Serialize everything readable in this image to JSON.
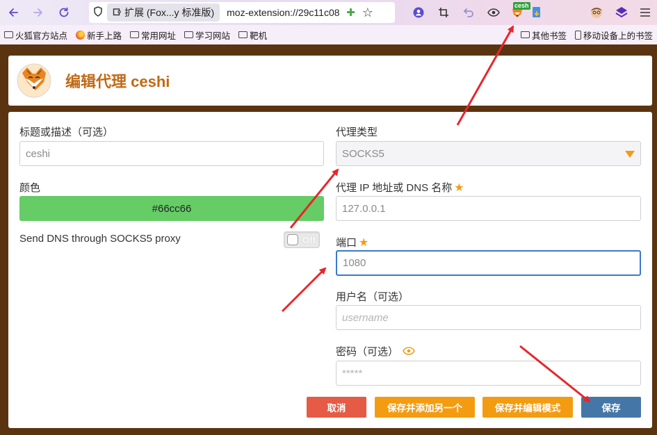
{
  "browser": {
    "tab_label": "扩展 (Fox...y 标准版)",
    "url": "moz-extension://29c11c08",
    "extension_badge": "cesh"
  },
  "bookmarks": {
    "left": [
      "火狐官方站点",
      "新手上路",
      "常用网址",
      "学习网站",
      "靶机"
    ],
    "right": [
      "其他书签",
      "移动设备上的书签"
    ]
  },
  "header": {
    "title": "编辑代理 ceshi"
  },
  "form": {
    "title_label": "标题或描述（可选）",
    "title_value": "ceshi",
    "color_label": "颜色",
    "color_value": "#66cc66",
    "dns_label": "Send DNS through SOCKS5 proxy",
    "dns_toggle": "Off",
    "type_label": "代理类型",
    "type_value": "SOCKS5",
    "ip_label": "代理 IP 地址或 DNS 名称",
    "ip_value": "127.0.0.1",
    "port_label": "端口",
    "port_value": "1080",
    "username_label": "用户名（可选）",
    "username_placeholder": "username",
    "password_label": "密码（可选）",
    "password_placeholder": "*****"
  },
  "buttons": {
    "cancel": "取消",
    "save_add_another": "保存并添加另一个",
    "save_edit_mode": "保存并编辑模式",
    "save": "保存"
  },
  "colors": {
    "accent_orange": "#f39c12",
    "title_color": "#c06914",
    "cancel_red": "#e55b45",
    "save_blue": "#4477a8",
    "swatch": "#66cc66",
    "annotation_red": "#e8262b"
  }
}
